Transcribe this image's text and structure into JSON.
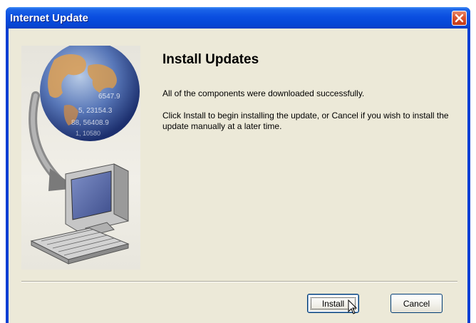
{
  "window": {
    "title": "Internet Update",
    "close_icon": "close-icon"
  },
  "main": {
    "heading": "Install Updates",
    "message": "All of the components were downloaded successfully.",
    "instructions": "Click Install to begin installing the update, or Cancel if you wish to install the update manually at a later time."
  },
  "side_image": {
    "globe_numbers": [
      "6547.9",
      "5, 23154.3",
      "88, 56408.9",
      "1, 10580"
    ]
  },
  "buttons": {
    "install_label": "Install",
    "cancel_label": "Cancel"
  },
  "colors": {
    "titlebar": "#0a4ee0",
    "client_bg": "#ece9d8",
    "close_button": "#d9532e"
  }
}
